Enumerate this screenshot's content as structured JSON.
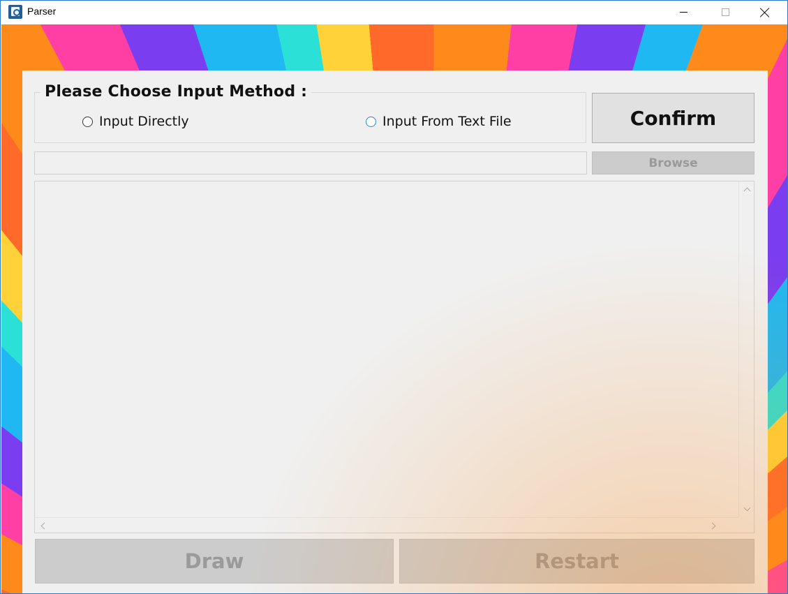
{
  "window": {
    "title": "Parser"
  },
  "input_method": {
    "heading": "Please Choose Input Method :",
    "options": [
      {
        "label": "Input Directly",
        "selected": false
      },
      {
        "label": "Input From Text File",
        "selected": false
      }
    ]
  },
  "actions": {
    "confirm_label": "Confirm",
    "browse_label": "Browse",
    "draw_label": "Draw",
    "restart_label": "Restart"
  },
  "file_path": {
    "value": "",
    "placeholder": ""
  },
  "editor": {
    "content": ""
  },
  "icons": {
    "app": "parser-app-icon",
    "minimize": "minimize-icon",
    "maximize": "maximize-icon",
    "close": "close-icon"
  },
  "colors": {
    "panel_bg": "#f0f0f0",
    "disabled_button_bg": "#cccccc",
    "disabled_text": "#9a9a9a",
    "radio_hover": "#2a86d8",
    "window_border": "#2b78c6"
  }
}
